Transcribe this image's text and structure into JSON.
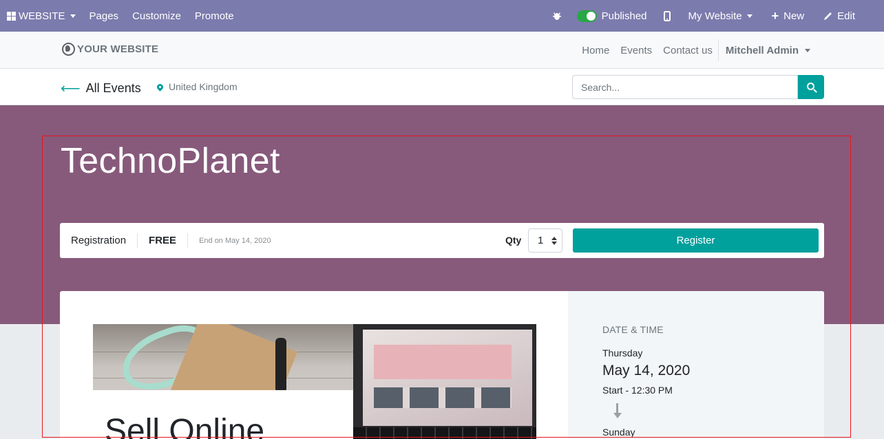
{
  "adminbar": {
    "app_menu": "WEBSITE",
    "menu_pages": "Pages",
    "menu_customize": "Customize",
    "menu_promote": "Promote",
    "publish_status": "Published",
    "website_selector": "My Website",
    "new_label": "New",
    "edit_label": "Edit"
  },
  "header": {
    "logo_text": "YOUR WEBSITE",
    "nav": [
      "Home",
      "Events",
      "Contact us"
    ],
    "user": "Mitchell Admin"
  },
  "subnav": {
    "back_label": "All Events",
    "location": "United Kingdom",
    "search_placeholder": "Search..."
  },
  "event": {
    "title": "TechnoPlanet",
    "registration": {
      "label": "Registration",
      "price": "FREE",
      "end_text": "End on May 14, 2020",
      "qty_label": "Qty",
      "qty_value": "1",
      "register_button": "Register"
    },
    "cover_heading": "Sell Online",
    "datetime": {
      "heading": "DATE & TIME",
      "start_day": "Thursday",
      "start_date": "May 14, 2020",
      "start_time": "Start - 12:30 PM",
      "end_day": "Sunday"
    }
  },
  "colors": {
    "adminbar": "#7c7bad",
    "primary": "#00a09d",
    "hero": "#875a7b",
    "highlight_box": "#e8141c"
  }
}
